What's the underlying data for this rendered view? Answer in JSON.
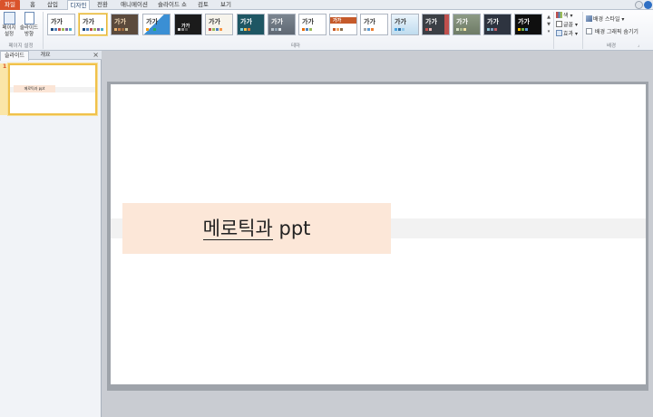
{
  "menu": {
    "tabs": [
      "파일",
      "홈",
      "삽입",
      "디자인",
      "전환",
      "애니메이션",
      "슬라이드 쇼",
      "검토",
      "보기"
    ]
  },
  "ribbon": {
    "page_setup": {
      "btn1": "페이지 설정",
      "btn2": "슬라이드 방향",
      "group": "페이지 설정"
    },
    "themes": {
      "group": "테마",
      "sample_text": "가가",
      "scroll_up": "▲",
      "scroll_down": "▼",
      "scroll_more": "▾"
    },
    "theme_options": {
      "colors": "색",
      "fonts": "글꼴",
      "effects": "효과"
    },
    "background": {
      "styles": "배경 스타일",
      "hide_graphics": "배경 그래픽 숨기기",
      "group": "배경"
    }
  },
  "left_pane": {
    "tab_slides": "슬라이드",
    "tab_outline": "개요",
    "close": "×",
    "slide_number": "1",
    "thumb_title": "메로틱과 ppt"
  },
  "slide": {
    "title_word": "메로틱과",
    "title_rest": " ppt"
  },
  "colors": {
    "file_tab": "#d9532b",
    "title_fill": "#fce7d8",
    "selection": "#f0c14b"
  }
}
